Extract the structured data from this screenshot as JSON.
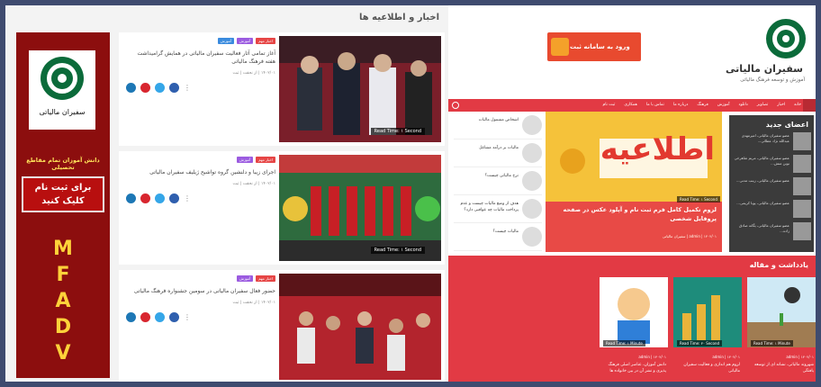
{
  "left": {
    "section_title": "اخبار و اطلاعیه ها",
    "ad": {
      "logo_text": "سفیران مالیاتی",
      "caption": "دانش آموزان تمام مقاطع تحصیلی",
      "button_line1": "برای ثبت نام",
      "button_line2": "کلیک کنید",
      "letters": [
        "M",
        "F",
        "A",
        "D",
        "V"
      ]
    },
    "news": [
      {
        "tags": [
          "اخبار مهم",
          "آموزش",
          "آموزش"
        ],
        "title": "آغاز تمامی آثار فعالیت سفیران مالیاتی در همایش گرامیداشت هفته فرهنگ مالیاتی",
        "date": "۱۴۰۲/۰۱ | از نحقت | ثبت",
        "time_label": "Read Time: ۱ Second"
      },
      {
        "tags": [
          "اخبار مهم",
          "آموزش"
        ],
        "title": "اجرای زیبا و دلنشین گروه تواشیح ژیلیف سفیران مالیاتی",
        "date": "۱۴۰۲/۰۱ | از نحقت | ثبت",
        "time_label": "Read Time: ۱ Second"
      },
      {
        "tags": [
          "اخبار مهم",
          "آموزش"
        ],
        "title": "حضور فعال سفیران مالیاتی در سومین جشنواره فرهنگ مالیاتی",
        "date": "۱۴۰۲/۰۱ | از نحقت | ثبت",
        "time_label": "Read Time: ۱ Second"
      }
    ]
  },
  "right": {
    "site_name": "سفیران مالیاتی",
    "site_sub": "آموزش و توسعه فرهنگ مالیاتی",
    "banner_text": "ورود به سامانه ثبت نام",
    "nav": [
      "خانه",
      "اخبار",
      "تصاویر",
      "دانلود",
      "آموزش",
      "فرهنگ",
      "درباره ما",
      "تماس با ما",
      "همکاری",
      "ثبت نام"
    ],
    "members_title": "اعضای جدید",
    "members": [
      "عضو سفیران مالیاتی، امیرمهدی عبدالله نژاد عطائی...",
      "عضو سفیران مالیاتی، مریم شاهرخی نوین منش...",
      "عضو سفیران مالیاتی، زینب مدنی...",
      "عضو سفیران مالیاتی، پویا کریمی...",
      "عضو سفیران مالیاتی، یگانه صادق زاده..."
    ],
    "feature": {
      "image_word": "اطلاعیه",
      "time_label": "Read Time: ۱ Second",
      "title": "لزوم تکمیل کامل فرم ثبت نام و آپلود عکس در صفحه پروفایل شخصی",
      "meta": "admin | ۱۴۰۲/۰۱ | سفیران مالیاتی"
    },
    "side_items": [
      "اشخاص مشمول مالیات",
      "مالیات بر درآمد مشاغل",
      "نرخ مالیاتی چیست؟",
      "هدف از وضع مالیات چیست و عدم پرداخت مالیات چه عواقبی دارد؟",
      "مالیات چیست؟"
    ],
    "notes_title": "یادداشت و مقاله",
    "notes": [
      {
        "title": "شهروند مالیاتی، نشانه ای از توسعه یافتگی",
        "meta": "admin | ۱۴۰۲/۰۱",
        "time_label": "Read Time: ۱ Minute"
      },
      {
        "title": "لزوم هم اندازی و فعالیت سفیران مالیاتی",
        "meta": "admin | ۱۴۰۲/۰۱",
        "time_label": "Read Time: ۳۰ Second"
      },
      {
        "title": "دانش آموزان، عناصر اصلی فرهنگ پذیری و نشر آن در بین خانواده ها",
        "meta": "admin | ۱۴۰۲/۰۱",
        "time_label": "Read Time: ۱ Minute"
      }
    ]
  }
}
